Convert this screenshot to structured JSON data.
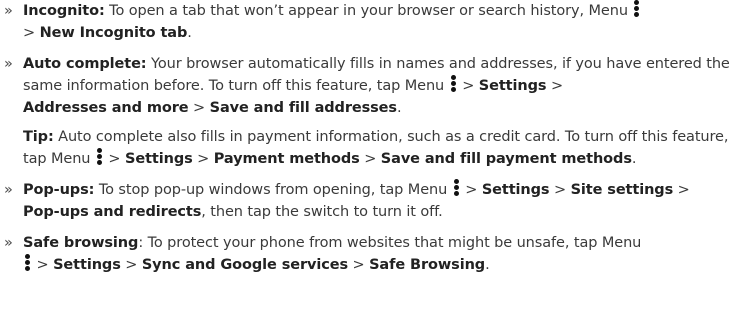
{
  "bullet_marker": "»",
  "separator": ">",
  "incognito": {
    "label": "Incognito:",
    "text1": " To open a tab that won’t appear in your browser or search history, Menu ",
    "item1": "New Incognito tab",
    "end": "."
  },
  "autocomplete": {
    "label": "Auto complete:",
    "text1": " Your browser automatically fills in names and addresses, if you have entered the same information before. To turn off this feature, tap Menu ",
    "item1": "Settings",
    "item2": "Addresses and more",
    "item3": "Save and fill addresses",
    "end": "."
  },
  "tip": {
    "label": "Tip:",
    "text1": " Auto complete also fills in payment information, such as a credit card. To turn off this feature, tap Menu ",
    "item1": "Settings",
    "item2": "Payment methods",
    "item3": "Save and fill payment methods",
    "end": "."
  },
  "popups": {
    "label": "Pop-ups:",
    "text1": " To stop pop-up windows from opening, tap Menu ",
    "item1": "Settings",
    "item2": "Site settings",
    "item3": "Pop-ups and redirects",
    "end": ", then tap the switch to turn it off."
  },
  "safe": {
    "label": "Safe browsing",
    "text1": ": To protect your phone from websites that might be unsafe, tap Menu ",
    "item1": "Settings",
    "item2": "Sync and Google services",
    "item3": "Safe Browsing",
    "end": "."
  }
}
